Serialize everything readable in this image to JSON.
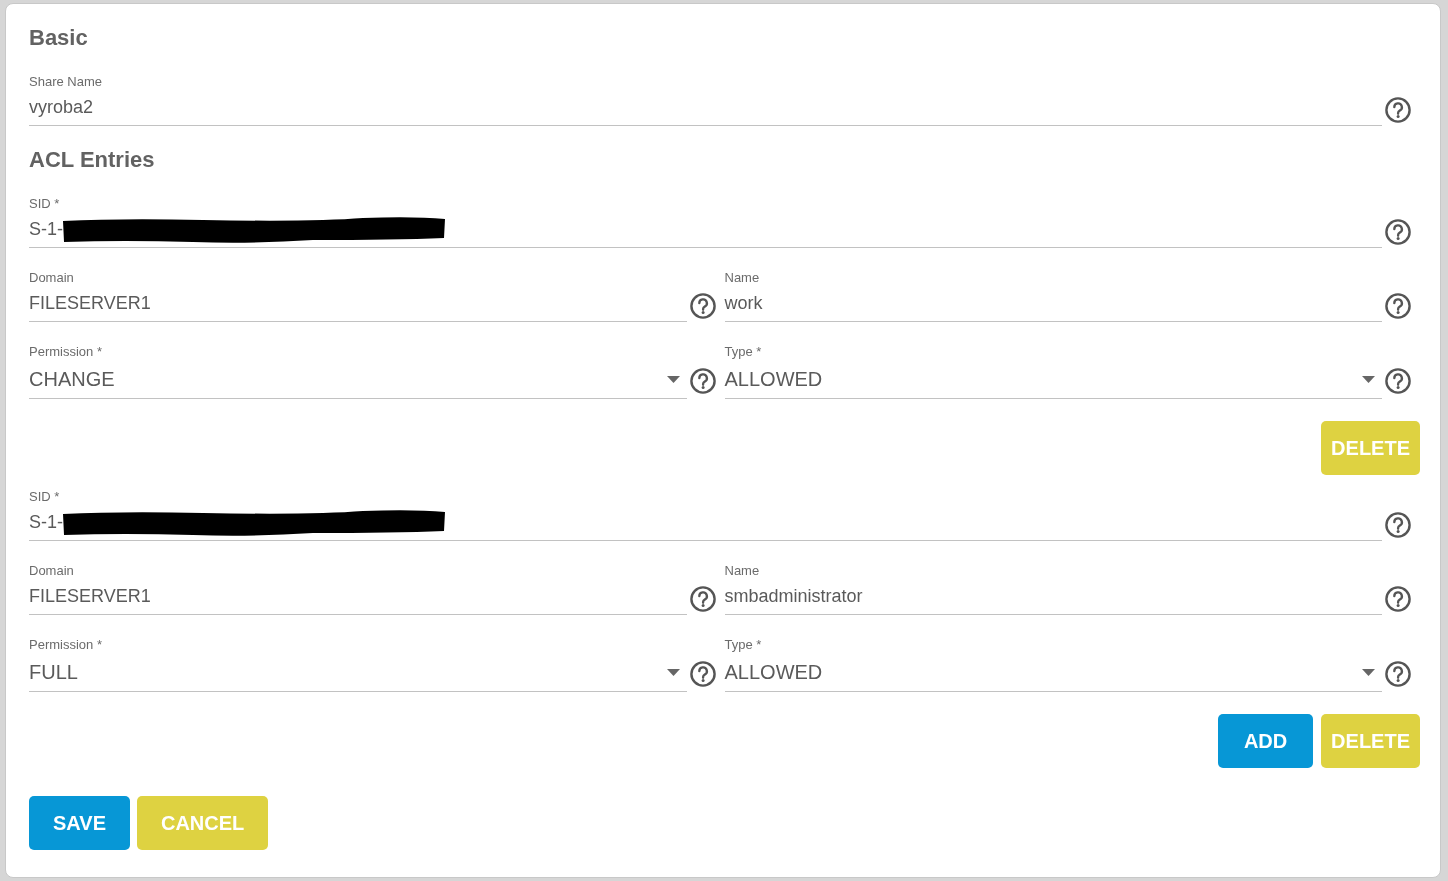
{
  "basic": {
    "heading": "Basic",
    "rows": [
      {
        "fields": [
          {
            "kind": "text",
            "label": "Share Name",
            "value": "vyroba2"
          }
        ]
      }
    ]
  },
  "acl": {
    "heading": "ACL Entries",
    "entries": [
      {
        "rows": [
          {
            "fields": [
              {
                "kind": "text",
                "label": "SID *",
                "value": "S-1-",
                "redacted": true
              }
            ]
          },
          {
            "fields": [
              {
                "kind": "text",
                "label": "Domain",
                "value": "FILESERVER1"
              },
              {
                "kind": "text",
                "label": "Name",
                "value": "work"
              }
            ]
          },
          {
            "fields": [
              {
                "kind": "select",
                "label": "Permission *",
                "value": "CHANGE"
              },
              {
                "kind": "select",
                "label": "Type *",
                "value": "ALLOWED"
              }
            ]
          }
        ],
        "buttons": [
          {
            "kind": "delete",
            "label": "DELETE"
          }
        ]
      },
      {
        "rows": [
          {
            "fields": [
              {
                "kind": "text",
                "label": "SID *",
                "value": "S-1-",
                "redacted": true
              }
            ]
          },
          {
            "fields": [
              {
                "kind": "text",
                "label": "Domain",
                "value": "FILESERVER1"
              },
              {
                "kind": "text",
                "label": "Name",
                "value": "smbadministrator"
              }
            ]
          },
          {
            "fields": [
              {
                "kind": "select",
                "label": "Permission *",
                "value": "FULL"
              },
              {
                "kind": "select",
                "label": "Type *",
                "value": "ALLOWED"
              }
            ]
          }
        ],
        "buttons": [
          {
            "kind": "add",
            "label": "ADD"
          },
          {
            "kind": "delete",
            "label": "DELETE"
          }
        ]
      }
    ]
  },
  "actions": [
    {
      "kind": "save",
      "label": "SAVE"
    },
    {
      "kind": "cancel",
      "label": "CANCEL"
    }
  ]
}
